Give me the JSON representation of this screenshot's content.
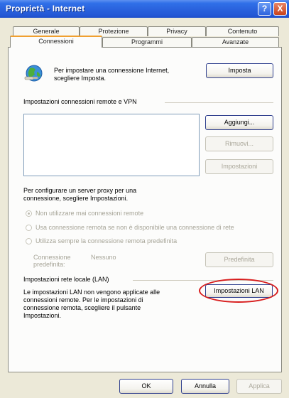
{
  "window": {
    "title": "Proprietà - Internet",
    "help_glyph": "?",
    "close_glyph": "X"
  },
  "tabs_row1": [
    "Generale",
    "Protezione",
    "Privacy",
    "Contenuto"
  ],
  "tabs_row2": [
    "Connessioni",
    "Programmi",
    "Avanzate"
  ],
  "active_tab": "Connessioni",
  "setup": {
    "text_line1": "Per impostare una connessione Internet,",
    "text_line2": "scegliere Imposta.",
    "button": "Imposta"
  },
  "remote_vpn": {
    "heading": "Impostazioni connessioni remote e VPN",
    "add_button": "Aggiungi...",
    "remove_button": "Rimuovi...",
    "settings_button": "Impostazioni"
  },
  "proxy": {
    "text_line1": "Per configurare un server proxy per una",
    "text_line2": "connessione, scegliere Impostazioni."
  },
  "dial_options": [
    "Non utilizzare mai connessioni remote",
    "Usa connessione remota se non è disponibile una connessione di rete",
    "Utilizza sempre la connessione remota predefinita"
  ],
  "default_connection": {
    "label_line1": "Connessione",
    "label_line2": "predefinita:",
    "value": "Nessuno",
    "button": "Predefinita"
  },
  "lan": {
    "heading": "Impostazioni rete locale (LAN)",
    "text_line1": "Le impostazioni LAN non vengono applicate alle",
    "text_line2": "connessioni remote. Per le impostazioni di",
    "text_line3": "connessione remota, scegliere il pulsante",
    "text_line4": "Impostazioni.",
    "button": "Impostazioni LAN"
  },
  "footer": {
    "ok": "OK",
    "cancel": "Annulla",
    "apply": "Applica"
  },
  "colors": {
    "title_blue": "#2a63de",
    "highlight_red": "#d81e1e",
    "dialog_bg": "#ece9d8"
  }
}
